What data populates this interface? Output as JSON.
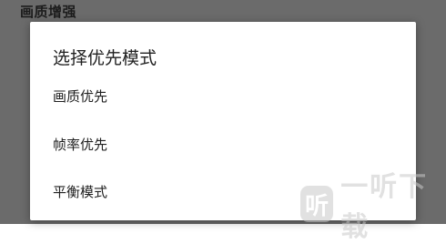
{
  "page": {
    "title": "画质增强"
  },
  "dialog": {
    "title": "选择优先模式",
    "options": [
      {
        "label": "画质优先"
      },
      {
        "label": "帧率优先"
      },
      {
        "label": "平衡模式"
      }
    ]
  },
  "watermark": {
    "logo_char": "听",
    "text": "一听下载"
  },
  "colors": {
    "backdrop": "#6b6b6b",
    "dialog_bg": "#ffffff",
    "text": "#212121",
    "watermark": "#c9c9c9"
  }
}
